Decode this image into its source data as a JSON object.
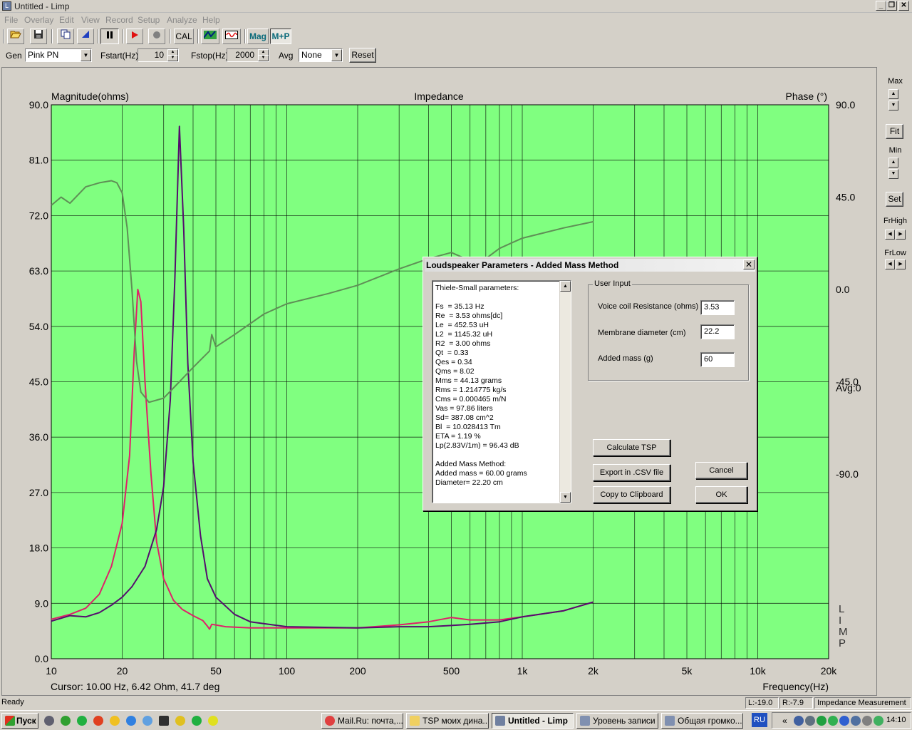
{
  "window": {
    "title": "Untitled - Limp",
    "min_glyph": "_",
    "max_glyph": "❐",
    "close_glyph": "✕"
  },
  "menu": [
    "File",
    "Overlay",
    "Edit",
    "View",
    "Record",
    "Setup",
    "Analyze",
    "Help"
  ],
  "toolbar": {
    "cal_label": "CAL",
    "mag_label": "Mag",
    "mp_label": "M+P"
  },
  "controls": {
    "gen_label": "Gen",
    "gen_value": "Pink PN",
    "fstart_label": "Fstart(Hz)",
    "fstart_value": "10",
    "fstop_label": "Fstop(Hz)",
    "fstop_value": "2000",
    "avg_label": "Avg",
    "avg_value": "None",
    "reset_label": "Reset"
  },
  "right_panel": {
    "max_label": "Max",
    "fit_label": "Fit",
    "min_label": "Min",
    "set_label": "Set",
    "frhigh_label": "FrHigh",
    "frlow_label": "FrLow"
  },
  "chart_data": {
    "type": "line",
    "title": "Impedance",
    "ylabel": "Magnitude(ohms)",
    "y2label": "Phase (°)",
    "xlabel": "Frequency(Hz)",
    "xscale": "log",
    "xlim": [
      10,
      20000
    ],
    "ylim": [
      0,
      90
    ],
    "y2lim": [
      -180,
      90
    ],
    "x_ticks": [
      10,
      20,
      50,
      100,
      200,
      500,
      1000,
      2000,
      5000,
      10000,
      20000
    ],
    "x_tick_labels": [
      "10",
      "20",
      "50",
      "100",
      "200",
      "500",
      "1k",
      "2k",
      "5k",
      "10k",
      "20k"
    ],
    "y_tick_labels": [
      "90.0",
      "81.0",
      "72.0",
      "63.0",
      "54.0",
      "45.0",
      "36.0",
      "27.0",
      "18.0",
      "9.0",
      "0.0"
    ],
    "y2_tick_labels": [
      "90.0",
      "45.0",
      "0.0",
      "-45.0",
      "-90.0"
    ],
    "avg_text": "Avg:0",
    "cursor_text": "Cursor: 10.00 Hz, 6.42 Ohm, 41.7 deg",
    "watermark": "LIMP",
    "grid": true,
    "background": "#80ff80",
    "series": [
      {
        "color": "#e0206a",
        "points": [
          [
            10,
            6.4
          ],
          [
            12,
            7.2
          ],
          [
            14,
            8.2
          ],
          [
            16,
            10.5
          ],
          [
            18,
            15
          ],
          [
            20,
            22
          ],
          [
            21.5,
            33
          ],
          [
            22.5,
            50
          ],
          [
            23.3,
            60
          ],
          [
            24,
            58
          ],
          [
            25,
            45
          ],
          [
            26.5,
            30
          ],
          [
            28,
            19
          ],
          [
            30,
            13
          ],
          [
            33,
            9.5
          ],
          [
            36,
            8
          ],
          [
            40,
            7
          ],
          [
            44,
            6.2
          ],
          [
            46,
            5.3
          ],
          [
            47,
            4.8
          ],
          [
            48,
            5.6
          ],
          [
            55,
            5.2
          ],
          [
            70,
            5
          ],
          [
            100,
            5
          ],
          [
            200,
            5
          ],
          [
            300,
            5.5
          ],
          [
            400,
            6
          ],
          [
            500,
            6.7
          ],
          [
            600,
            6.3
          ],
          [
            800,
            6.3
          ],
          [
            1000,
            6.8
          ],
          [
            1500,
            7.8
          ],
          [
            2000,
            9.2
          ]
        ]
      },
      {
        "color": "#550d6e",
        "points": [
          [
            10,
            6.1
          ],
          [
            12,
            7
          ],
          [
            14,
            6.8
          ],
          [
            16,
            7.5
          ],
          [
            18,
            8.7
          ],
          [
            20,
            10
          ],
          [
            22,
            11.7
          ],
          [
            25,
            15
          ],
          [
            28,
            21
          ],
          [
            30,
            28
          ],
          [
            32,
            42
          ],
          [
            33.5,
            62
          ],
          [
            35,
            86.5
          ],
          [
            36.5,
            70
          ],
          [
            38,
            48
          ],
          [
            40,
            32
          ],
          [
            43,
            20
          ],
          [
            46,
            13
          ],
          [
            50,
            10
          ],
          [
            60,
            7.2
          ],
          [
            70,
            6
          ],
          [
            100,
            5.2
          ],
          [
            200,
            5
          ],
          [
            300,
            5.2
          ],
          [
            400,
            5.2
          ],
          [
            500,
            5.4
          ],
          [
            600,
            5.6
          ],
          [
            800,
            6
          ],
          [
            1000,
            6.8
          ],
          [
            1500,
            7.8
          ],
          [
            2000,
            9.2
          ]
        ]
      },
      {
        "color": "#5f8f56",
        "axis": "y2",
        "points": [
          [
            10,
            41
          ],
          [
            11,
            45
          ],
          [
            12,
            42
          ],
          [
            14,
            50
          ],
          [
            16,
            52
          ],
          [
            18,
            53
          ],
          [
            19,
            52
          ],
          [
            20,
            47
          ],
          [
            21,
            30
          ],
          [
            22,
            0
          ],
          [
            23,
            -35
          ],
          [
            24,
            -50
          ],
          [
            26,
            -55
          ],
          [
            30,
            -53
          ],
          [
            35,
            -45
          ],
          [
            40,
            -38
          ],
          [
            47,
            -30
          ],
          [
            48,
            -22
          ],
          [
            50,
            -28
          ],
          [
            60,
            -22
          ],
          [
            80,
            -12
          ],
          [
            100,
            -7
          ],
          [
            150,
            -2
          ],
          [
            200,
            2
          ],
          [
            300,
            10
          ],
          [
            400,
            15
          ],
          [
            500,
            18
          ],
          [
            600,
            14
          ],
          [
            700,
            15
          ],
          [
            800,
            20
          ],
          [
            1000,
            25
          ],
          [
            1500,
            30
          ],
          [
            2000,
            33
          ]
        ]
      }
    ]
  },
  "dialog": {
    "title": "Loudspeaker Parameters - Added Mass Method",
    "close_glyph": "✕",
    "params_lines": [
      "Thiele-Small parameters:",
      "",
      "Fs  = 35.13 Hz",
      "Re  = 3.53 ohms[dc]",
      "Le  = 452.53 uH",
      "L2  = 1145.32 uH",
      "R2  = 3.00 ohms",
      "Qt  = 0.33",
      "Qes = 0.34",
      "Qms = 8.02",
      "Mms = 44.13 grams",
      "Rms = 1.214775 kg/s",
      "Cms = 0.000465 m/N",
      "Vas = 97.86 liters",
      "Sd= 387.08 cm^2",
      "Bl  = 10.028413 Tm",
      "ETA = 1.19 %",
      "Lp(2.83V/1m) = 96.43 dB",
      "",
      "Added Mass Method:",
      "Added mass = 60.00 grams",
      "Diameter= 22.20 cm"
    ],
    "user_input_label": "User Input",
    "vc_label": "Voice coil Resistance (ohms)",
    "vc_value": "3.53",
    "md_label": "Membrane diameter (cm)",
    "md_value": "22.2",
    "am_label": "Added mass (g)",
    "am_value": "60",
    "calc_label": "Calculate TSP",
    "export_label": "Export in .CSV file",
    "copy_label": "Copy to Clipboard",
    "cancel_label": "Cancel",
    "ok_label": "OK"
  },
  "status": {
    "left": "Ready",
    "l": "L:-19.0",
    "r": "R:-7.9",
    "mode": "Impedance Measurement"
  },
  "taskbar": {
    "start_label": "Пуск",
    "tasks": [
      "Mail.Ru: почта,...",
      "TSP моих дина...",
      "Untitled - Limp",
      "Уровень записи",
      "Общая громко..."
    ],
    "lang": "RU",
    "clock": "14:10"
  }
}
